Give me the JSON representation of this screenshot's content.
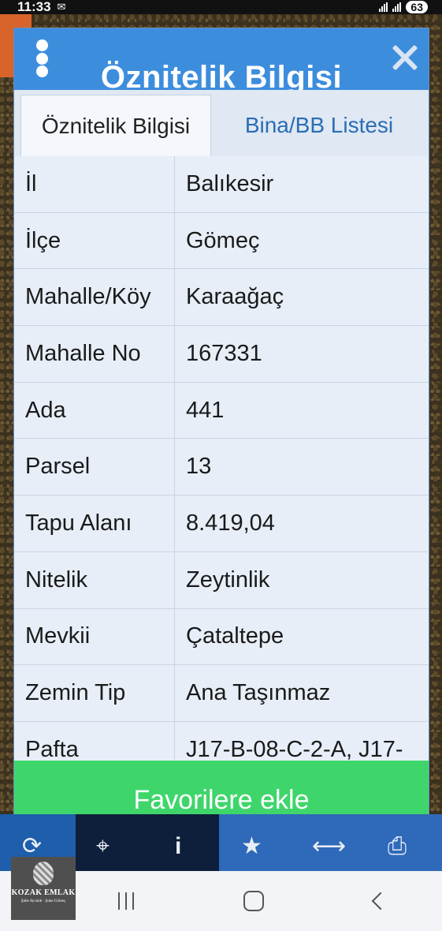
{
  "status_bar": {
    "time": "11:33",
    "battery": "63"
  },
  "dialog": {
    "title": "Öznitelik Bilgisi",
    "tabs": [
      {
        "label": "Öznitelik Bilgisi",
        "active": true
      },
      {
        "label": "Bina/BB Listesi",
        "active": false
      }
    ],
    "rows": [
      {
        "key": "İl",
        "value": "Balıkesir"
      },
      {
        "key": "İlçe",
        "value": "Gömeç"
      },
      {
        "key": "Mahalle/Köy",
        "value": "Karaağaç"
      },
      {
        "key": "Mahalle No",
        "value": "167331"
      },
      {
        "key": "Ada",
        "value": "441"
      },
      {
        "key": "Parsel",
        "value": "13"
      },
      {
        "key": "Tapu Alanı",
        "value": "8.419,04"
      },
      {
        "key": "Nitelik",
        "value": "Zeytinlik"
      },
      {
        "key": "Mevkii",
        "value": "Çataltepe"
      },
      {
        "key": "Zemin Tip",
        "value": "Ana Taşınmaz"
      },
      {
        "key": "Pafta",
        "value": "J17-B-08-C-2-A, J17-"
      }
    ],
    "favorite_button": "Favorilere ekle"
  },
  "logo": {
    "name": "KOZAK EMLAK",
    "sub": "Şube Ayvalık · Şube Gömeç"
  },
  "colors": {
    "header": "#3d8ddd",
    "favorite_button": "#3ed66b",
    "tab_link": "#2a6db3"
  },
  "icons": [
    "menu-icon",
    "close-icon",
    "refresh-icon",
    "locate-icon",
    "info-icon",
    "star-icon",
    "measure-icon",
    "print-icon"
  ]
}
